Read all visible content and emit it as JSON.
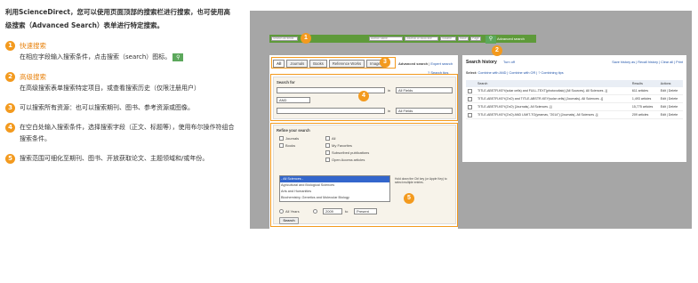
{
  "left": {
    "intro": "利用ScienceDirect，您可以使用页面顶部的搜索栏进行搜索，也可使用高级搜索（Advanced Search）表单进行特定搜索。",
    "steps": [
      {
        "num": "1",
        "title": "快速搜索",
        "text": "在相应字段输入搜索条件，点击搜索（search）图标。"
      },
      {
        "num": "2",
        "title": "高级搜索",
        "text": "在高级搜索表单搜索特定项目，或查看搜索历史（仅限注册用户）"
      },
      {
        "num": "3",
        "title": "",
        "text": "可以搜索所有资源：也可以搜索期刊、图书、参考资源或图像。"
      },
      {
        "num": "4",
        "title": "",
        "text": "在空白处输入搜索条件，选择搜索字段（正文、标题等），使用布尔操作符组合搜索条件。"
      },
      {
        "num": "5",
        "title": "",
        "text": "搜索范围可细化至期刊、图书、开放获取论文、主题领域和/或年份。"
      }
    ]
  },
  "shot": {
    "topbar": {
      "f1": "Search all fields",
      "f2": "Author name",
      "f3": "Journal or book title",
      "f4": "Volume",
      "f5": "Issue",
      "f6": "Page",
      "adv": "Advanced search",
      "search_icon": "search-icon"
    },
    "tabs": [
      "All",
      "Journals",
      "Books",
      "Reference Works",
      "Images"
    ],
    "adv_links": [
      "Advanced search",
      "Expert search"
    ],
    "search_tips": "Search tips",
    "search_for": "Search for",
    "in": "in",
    "field1": "All Fields",
    "bool": "AND",
    "field2": "All Fields",
    "refine": "Refine your search",
    "refine_items": [
      "Journals",
      "Books",
      "All",
      "My Favorites",
      "Subscribed publications",
      "Open Access articles"
    ],
    "subjects": [
      "- All Sciences -",
      "Agricultural and Biological Sciences",
      "Arts and Humanities",
      "Biochemistry, Genetics and Molecular Biology"
    ],
    "hold_hint": "Hold down the Ctrl key (or Apple Key) to select multiple entries.",
    "years_label": "All Years",
    "year_from": "2009",
    "to": "to",
    "year_to": "Present",
    "search_btn": "Search",
    "history": {
      "title": "Search history",
      "turn_off": "Turn off",
      "actions": "Save history as | Recall history | Clear all | Print",
      "select": "Select:",
      "combine": "Combine with AND | Combine with OR | ? Combining tips",
      "cols": [
        "Search",
        "Results",
        "Actions"
      ],
      "rows": [
        {
          "q": "TITLE-ABSTR-KEY(solar cells) and FULL-TEXT(photovoltaic) [All Sources(- All Sciences -)]",
          "r": "611 articles",
          "a": "Edit | Delete"
        },
        {
          "q": "TITLE-ABSTR-KEY(ZnO) and TITLE-ABSTR-KEY(solar cells) [Journals(- All Sciences -)]",
          "r": "1,493 articles",
          "a": "Edit | Delete"
        },
        {
          "q": "TITLE-ABSTR-KEY(ZnO) [Journals(- All Sciences -)]",
          "r": "15,775 articles",
          "a": "Edit | Delete"
        },
        {
          "q": "TITLE-ABSTR-KEY(ZnO) AND LIMIT-TO(yearnav, \"2014\") [Journals(- All Sciences -)]",
          "r": "209 articles",
          "a": "Edit | Delete"
        }
      ]
    },
    "badges": [
      "1",
      "2",
      "3",
      "4",
      "5",
      "5"
    ]
  }
}
